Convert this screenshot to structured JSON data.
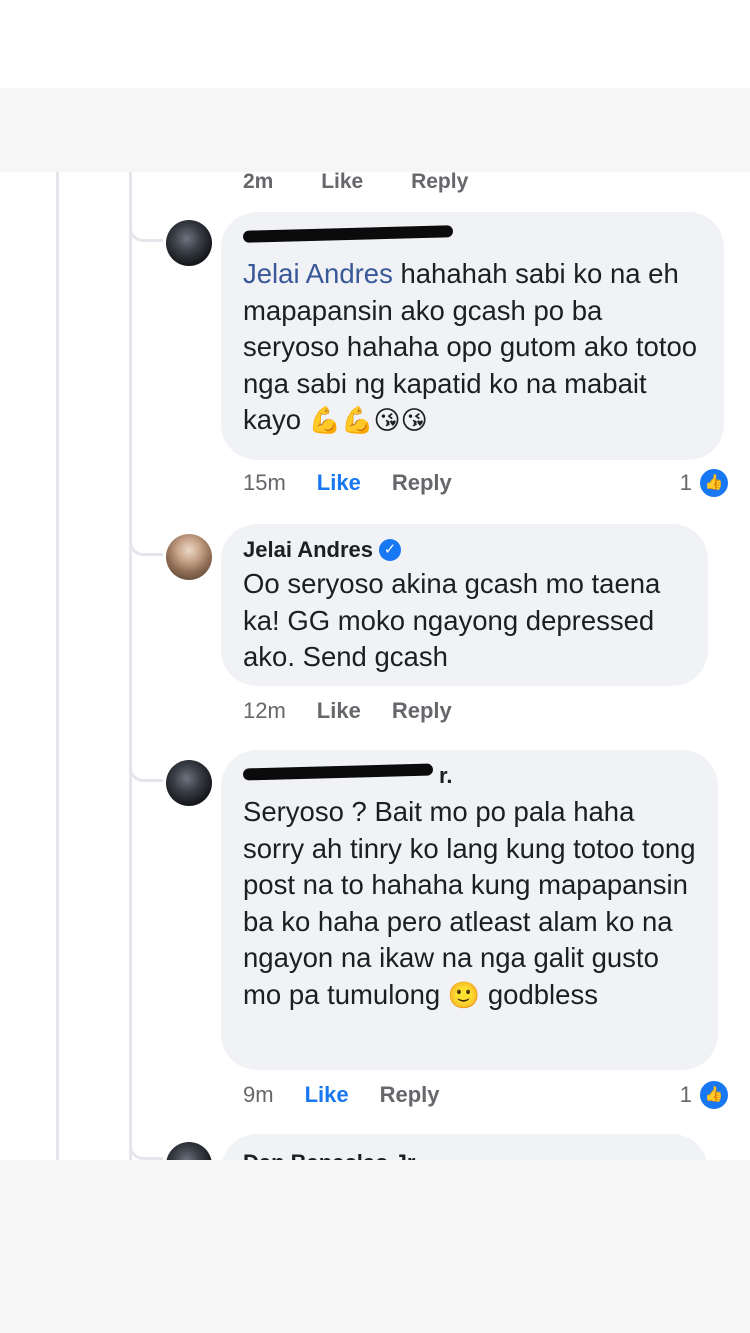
{
  "previous_actions": {
    "time": "2m",
    "like": "Like",
    "reply": "Reply"
  },
  "comments": [
    {
      "author": "",
      "mention": "Jelai Andres",
      "text": " hahahah sabi ko na eh mapapansin ako gcash po ba seryoso hahaha opo gutom ako totoo nga sabi ng kapatid ko na mabait kayo",
      "emojis": "💪💪😘😘",
      "time": "15m",
      "like": "Like",
      "reply": "Reply",
      "reaction_count": "1",
      "like_active": true
    },
    {
      "author": "Jelai Andres",
      "verified": true,
      "text": "Oo seryoso akina gcash mo taena ka! GG moko ngayong depressed ako. Send gcash",
      "time": "12m",
      "like": "Like",
      "reply": "Reply"
    },
    {
      "author": "r.",
      "text": "Seryoso ? Bait mo po pala haha sorry ah tinry ko lang kung totoo tong post na to hahaha kung mapapansin ba ko haha pero atleast alam ko na ngayon na ikaw na nga galit gusto mo pa tumulong",
      "emoji": "🙂",
      "text_after_emoji": " godbless",
      "time": "9m",
      "like": "Like",
      "reply": "Reply",
      "reaction_count": "1",
      "like_active": true
    }
  ],
  "next_comment_author": "Dan Banaclao Jr.",
  "icons": {
    "verified": "verified-check-icon",
    "like_reaction": "thumbs-up-icon",
    "check_glyph": "✓",
    "thumb_glyph": "👍"
  },
  "colors": {
    "bubble": "#f0f2f5",
    "link": "#385898",
    "like_active": "#1877f2",
    "meta_text": "#65676b"
  }
}
